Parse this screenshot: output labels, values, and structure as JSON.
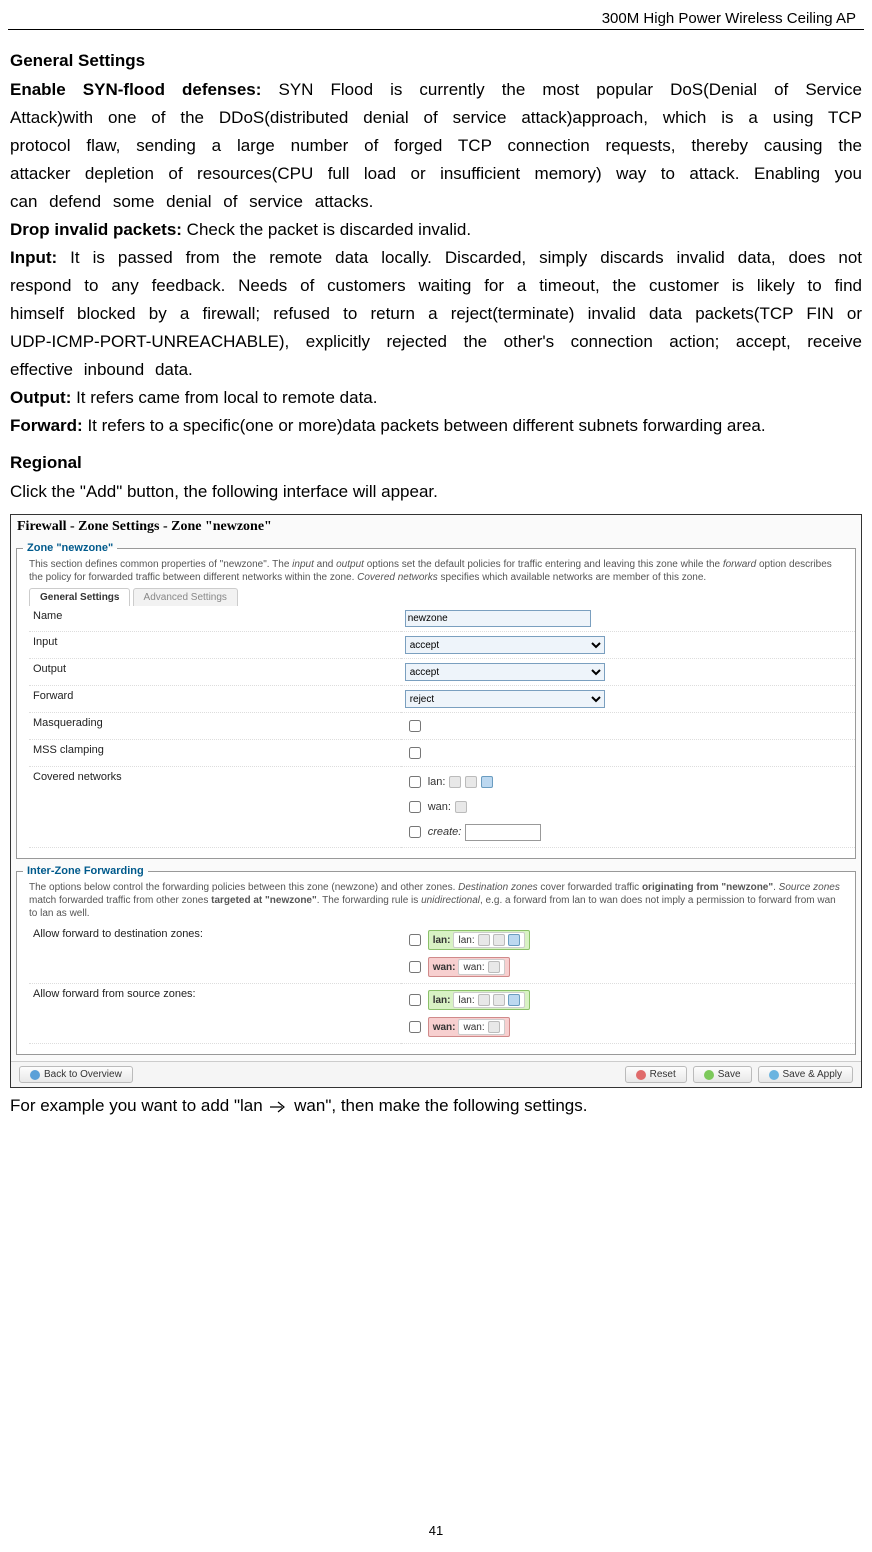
{
  "header": "300M High Power Wireless Ceiling AP",
  "page_number": "41",
  "doc": {
    "gs_title": "General Settings",
    "syn_label": "Enable SYN-flood defenses:",
    "syn_text": " SYN Flood is currently the most popular DoS(Denial of Service Attack)with one of the DDoS(distributed denial of service attack)approach, which is a using TCP protocol flaw, sending a large number of forged TCP connection requests, thereby causing the attacker depletion of resources(CPU full load or insufficient memory) way to attack. Enabling you can defend some denial of service attacks.",
    "drop_label": "Drop invalid packets:",
    "drop_text": " Check the packet is discarded invalid.",
    "input_label": "Input:",
    "input_text": " It is passed from the remote data locally. Discarded, simply discards invalid data, does not respond to any feedback. Needs of customers waiting for a timeout, the customer is likely to find himself blocked by a firewall; refused to return a reject(terminate) invalid data packets(TCP FIN or UDP-ICMP-PORT-UNREACHABLE), explicitly rejected the other's connection action; accept, receive effective inbound data.",
    "output_label": "Output:",
    "output_text": " It refers came from local to remote data.",
    "forward_label": "Forward:",
    "forward_text": " It refers to a specific(one or more)data packets between different subnets forwarding area.",
    "regional_title": "Regional",
    "regional_text": "Click the \"Add\" button, the following interface will appear.",
    "closing_pre": "For example you want to add \"lan",
    "closing_post": "wan\", then make the following settings."
  },
  "shot": {
    "title": "Firewall - Zone Settings - Zone \"newzone\"",
    "zone_legend": "Zone \"newzone\"",
    "zone_desc_pre": "This section defines common properties of \"newzone\". The ",
    "zone_desc_i1": "input",
    "zone_desc_mid1": " and ",
    "zone_desc_i2": "output",
    "zone_desc_mid2": " options set the default policies for traffic entering and leaving this zone while the ",
    "zone_desc_i3": "forward",
    "zone_desc_mid3": " option describes the policy for forwarded traffic between different networks within the zone. ",
    "zone_desc_i4": "Covered networks",
    "zone_desc_post": " specifies which available networks are member of this zone.",
    "tabs": {
      "general": "General Settings",
      "advanced": "Advanced Settings"
    },
    "fields": {
      "name_label": "Name",
      "name_value": "newzone",
      "input_label": "Input",
      "input_value": "accept",
      "output_label": "Output",
      "output_value": "accept",
      "forward_label": "Forward",
      "forward_value": "reject",
      "masq_label": "Masquerading",
      "mss_label": "MSS clamping",
      "covered_label": "Covered networks",
      "covered_opts": {
        "lan": "lan:",
        "wan": "wan:",
        "create": "create:"
      }
    },
    "izf": {
      "legend": "Inter-Zone Forwarding",
      "desc_pre": "The options below control the forwarding policies between this zone (newzone) and other zones. ",
      "desc_i1": "Destination zones",
      "desc_mid1": " cover forwarded traffic ",
      "desc_b1": "originating from \"newzone\"",
      "desc_mid2": ". ",
      "desc_i2": "Source zones",
      "desc_mid3": " match forwarded traffic from other zones ",
      "desc_b2": "targeted at \"newzone\"",
      "desc_mid4": ". The forwarding rule is ",
      "desc_i3": "unidirectional",
      "desc_post": ", e.g. a forward from lan to wan does not imply a permission to forward from wan to lan as well.",
      "dest_label": "Allow forward to destination zones:",
      "src_label": "Allow forward from source zones:",
      "lan_zone": "lan:",
      "lan_inner": "lan:",
      "wan_zone": "wan:",
      "wan_inner": "wan:"
    },
    "buttons": {
      "back": "Back to Overview",
      "reset": "Reset",
      "save": "Save",
      "apply": "Save & Apply"
    }
  }
}
